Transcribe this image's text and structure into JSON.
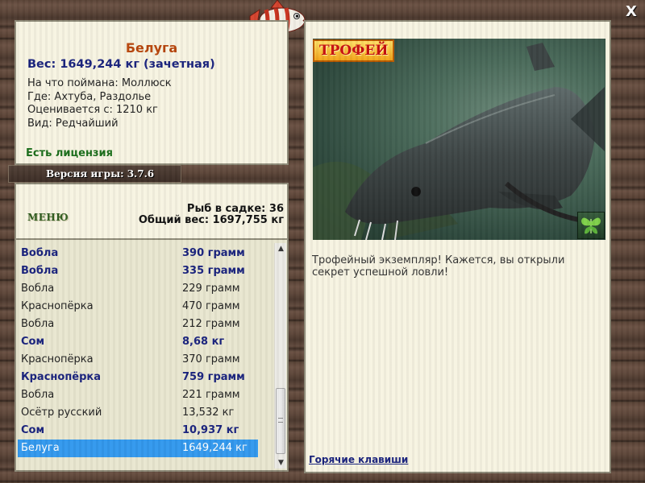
{
  "info": {
    "title": "Белуга",
    "weight": "Вес: 1649,244 кг (зачетная)",
    "caught_on": "На что поймана: Моллюск",
    "location": "Где: Ахтуба, Раздолье",
    "estimated": "Оценивается с: 1210 кг",
    "rarity": "Вид: Редчайший",
    "license": "Есть лицензия"
  },
  "version": "Версия игры: 3.7.6",
  "menu_label": "МЕНЮ",
  "stats": {
    "count": "Рыб в садке: 36",
    "total": "Общий вес: 1697,755 кг"
  },
  "catch_list": [
    {
      "name": "Вобла",
      "weight": "390 грамм",
      "highlight": true
    },
    {
      "name": "Вобла",
      "weight": "335 грамм",
      "highlight": true
    },
    {
      "name": "Вобла",
      "weight": "229 грамм",
      "highlight": false
    },
    {
      "name": "Краснопёрка",
      "weight": "470 грамм",
      "highlight": false
    },
    {
      "name": "Вобла",
      "weight": "212 грамм",
      "highlight": false
    },
    {
      "name": "Сом",
      "weight": "8,68 кг",
      "highlight": true
    },
    {
      "name": "Краснопёрка",
      "weight": "370 грамм",
      "highlight": false
    },
    {
      "name": "Краснопёрка",
      "weight": "759 грамм",
      "highlight": true
    },
    {
      "name": "Вобла",
      "weight": "221 грамм",
      "highlight": false
    },
    {
      "name": "Осётр русский",
      "weight": "13,532 кг",
      "highlight": false
    },
    {
      "name": "Сом",
      "weight": "10,937 кг",
      "highlight": true
    },
    {
      "name": "Белуга",
      "weight": "1649,244 кг",
      "highlight": false,
      "selected": true
    }
  ],
  "trophy_label": "ТРОФЕЙ",
  "description": "Трофейный экземпляр! Кажется, вы открыли секрет успешной ловли!",
  "hotkeys_label": "Горячие клавиши",
  "close_label": "X",
  "colors": {
    "panel_bg": "#f7f4e2",
    "list_bg": "#e9e7d0",
    "title_orange": "#b8460c",
    "accent_navy": "#1a237e",
    "license_green": "#1b6e1b",
    "selected_row": "#3399ee",
    "wood": "#5a4336"
  },
  "icons": {
    "close": "close-icon",
    "logo": "striped-fish-logo-icon",
    "trophy": "trophy-badge",
    "butterfly": "butterfly-icon"
  }
}
